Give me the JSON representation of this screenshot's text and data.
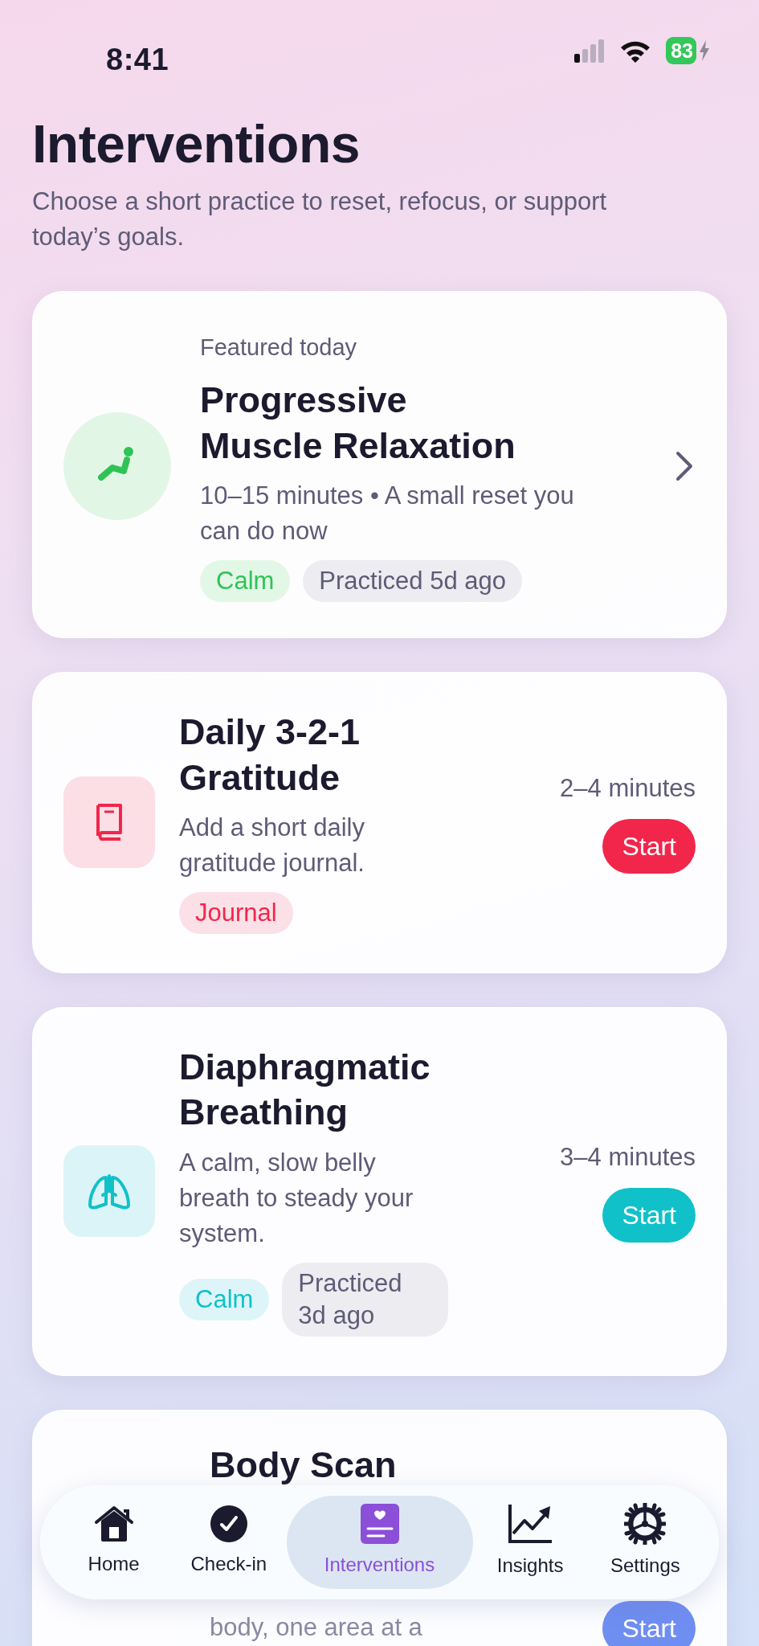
{
  "status_bar": {
    "time": "8:41",
    "battery": "83"
  },
  "header": {
    "title": "Interventions",
    "subtitle": "Choose a short practice to reset, refocus, or support today’s goals."
  },
  "featured": {
    "label": "Featured today",
    "title": "Progressive Muscle Relaxation",
    "description": "10–15 minutes • A small reset you can do now",
    "tags": [
      {
        "text": "Calm",
        "kind": "category"
      },
      {
        "text": "Practiced 5d ago",
        "kind": "history"
      }
    ]
  },
  "interventions": [
    {
      "title": "Daily 3-2-1 Gratitude",
      "description": "Add a short daily gratitude journal.",
      "duration": "2–4 minutes",
      "button": "Start",
      "color": "#f2264b",
      "tags": [
        {
          "text": "Journal",
          "kind": "category"
        }
      ]
    },
    {
      "title": "Diaphragmatic Breathing",
      "description": "A calm, slow belly breath to steady your system.",
      "duration": "3–4 minutes",
      "button": "Start",
      "color": "#10c1c9",
      "tags": [
        {
          "text": "Calm",
          "kind": "category"
        },
        {
          "text": "Practiced 3d ago",
          "kind": "history"
        }
      ]
    },
    {
      "title": "Body Scan",
      "description": "body, one area at a",
      "button": "Start",
      "color": "#6f8ef2"
    }
  ],
  "tab_bar": [
    {
      "label": "Home",
      "selected": false
    },
    {
      "label": "Check-in",
      "selected": false
    },
    {
      "label": "Interventions",
      "selected": true
    },
    {
      "label": "Insights",
      "selected": false
    },
    {
      "label": "Settings",
      "selected": false
    }
  ]
}
